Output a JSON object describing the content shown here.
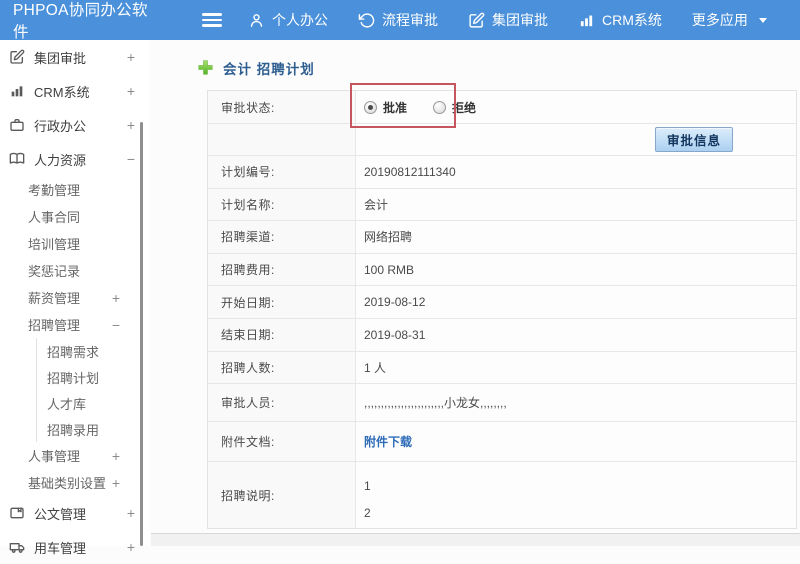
{
  "topbar": {
    "logo": "PHPOA协同办公软件",
    "items": [
      {
        "label": "个人办公",
        "icon": "person-icon"
      },
      {
        "label": "流程审批",
        "icon": "history-icon"
      },
      {
        "label": "集团审批",
        "icon": "edit-icon"
      },
      {
        "label": "CRM系统",
        "icon": "bar-chart-icon"
      },
      {
        "label": "更多应用",
        "icon": "caret-down-icon"
      }
    ]
  },
  "sidebar": {
    "items": [
      {
        "label": "集团审批",
        "toggle": "+",
        "level": 1,
        "icon": "edit-square-icon"
      },
      {
        "label": "CRM系统",
        "toggle": "+",
        "level": 1,
        "icon": "bar-chart-icon"
      },
      {
        "label": "行政办公",
        "toggle": "+",
        "level": 1,
        "icon": "briefcase-icon"
      },
      {
        "label": "人力资源",
        "toggle": "−",
        "level": 1,
        "icon": "book-icon"
      },
      {
        "label": "考勤管理",
        "toggle": "",
        "level": 2
      },
      {
        "label": "人事合同",
        "toggle": "",
        "level": 2
      },
      {
        "label": "培训管理",
        "toggle": "",
        "level": 2
      },
      {
        "label": "奖惩记录",
        "toggle": "",
        "level": 2
      },
      {
        "label": "薪资管理",
        "toggle": "+",
        "level": 2
      },
      {
        "label": "招聘管理",
        "toggle": "−",
        "level": 2
      },
      {
        "label": "招聘需求",
        "toggle": "",
        "level": 3
      },
      {
        "label": "招聘计划",
        "toggle": "",
        "level": 3
      },
      {
        "label": "人才库",
        "toggle": "",
        "level": 3
      },
      {
        "label": "招聘录用",
        "toggle": "",
        "level": 3
      },
      {
        "label": "人事管理",
        "toggle": "+",
        "level": 2
      },
      {
        "label": "基础类别设置",
        "toggle": "+",
        "level": 2
      },
      {
        "label": "公文管理",
        "toggle": "+",
        "level": 1,
        "icon": "document-icon"
      },
      {
        "label": "用车管理",
        "toggle": "+",
        "level": 1,
        "icon": "truck-icon"
      }
    ]
  },
  "main": {
    "page_title": "会计 招聘计划",
    "approval": {
      "status_label": "审批状态:",
      "options": [
        {
          "label": "批准",
          "selected": true
        },
        {
          "label": "拒绝",
          "selected": false
        }
      ],
      "info_button_label": "审批信息"
    },
    "fields": [
      {
        "label": "计划编号:",
        "value": "20190812111340"
      },
      {
        "label": "计划名称:",
        "value": "会计"
      },
      {
        "label": "招聘渠道:",
        "value": "网络招聘"
      },
      {
        "label": "招聘费用:",
        "value": "100 RMB"
      },
      {
        "label": "开始日期:",
        "value": "2019-08-12"
      },
      {
        "label": "结束日期:",
        "value": "2019-08-31"
      },
      {
        "label": "招聘人数:",
        "value": "1 人"
      },
      {
        "label": "审批人员:",
        "value": ",,,,,,,,,,,,,,,,,,,,,,,,小龙女,,,,,,,,"
      }
    ],
    "attachment": {
      "label": "附件文档:",
      "link_text": "附件下载"
    },
    "description": {
      "label": "招聘说明:",
      "value": "1\n2"
    }
  },
  "colors": {
    "topbar_blue": "#4a90da",
    "title_blue": "#2e5e90",
    "link_blue": "#2e6cb8",
    "annotation_red": "#c5555e",
    "button_face": "#bcd8f2"
  }
}
